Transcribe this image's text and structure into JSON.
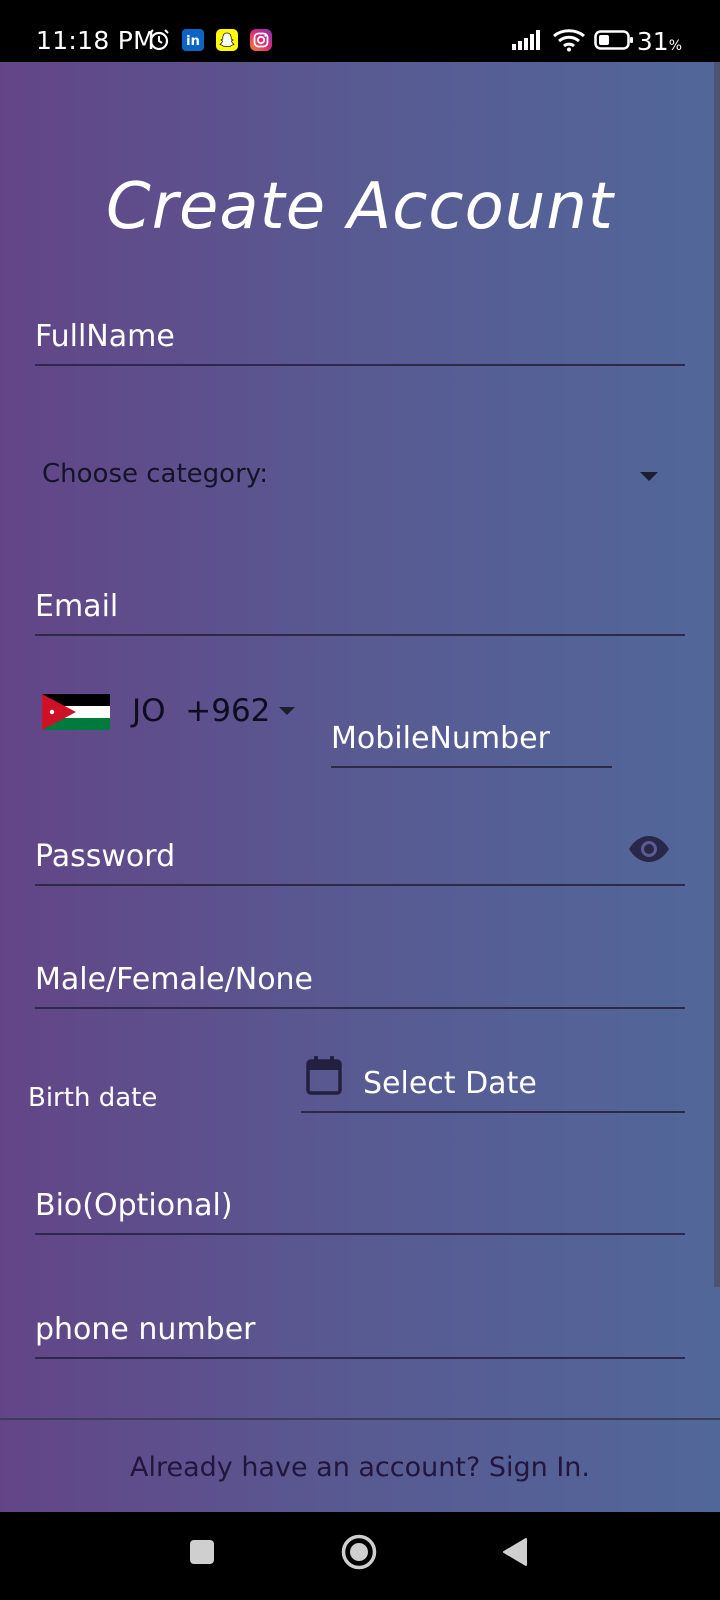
{
  "status_bar": {
    "time": "11:18 PM",
    "battery": "31",
    "battery_unit": "%",
    "icons": [
      "alarm-icon",
      "linkedin-icon",
      "snapchat-icon",
      "instagram-icon",
      "signal-icon",
      "wifi-icon",
      "battery-icon"
    ]
  },
  "page": {
    "title": "Create Account"
  },
  "form": {
    "full_name": "FullName",
    "category": "Choose category:",
    "email": "Email",
    "country_iso": "JO",
    "country_dial": "+962",
    "mobile_number": "MobileNumber",
    "password": "Password",
    "gender": "Male/Female/None",
    "birth_date_label": "Birth date",
    "select_date": "Select Date",
    "bio": "Bio(Optional)",
    "phone_number": "phone number"
  },
  "footer": {
    "sign_in_link": "Already have an account? Sign In."
  },
  "colors": {
    "gradient_start": "#634587",
    "gradient_end": "#51679a",
    "title": "#ffffff",
    "underline": "#2c2a48"
  },
  "nav": {
    "buttons": [
      "recents-button",
      "home-button",
      "back-button"
    ]
  }
}
